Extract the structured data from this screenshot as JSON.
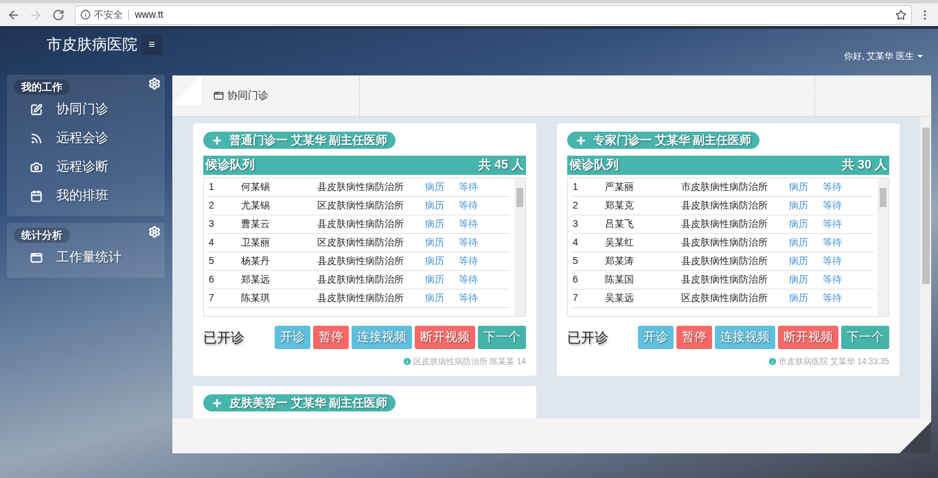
{
  "browser": {
    "security": "不安全",
    "url": "www.tt",
    "forward_disabled": true
  },
  "header": {
    "hospital": "市皮肤病医院",
    "menu_icon": "≡",
    "user": "你好, 艾某华 医生"
  },
  "sidebar": [
    {
      "title": "我的工作",
      "items": [
        {
          "label": "协同门诊"
        },
        {
          "label": "远程会诊"
        },
        {
          "label": "远程诊断"
        },
        {
          "label": "我的排班"
        }
      ]
    },
    {
      "title": "统计分析",
      "items": [
        {
          "label": "工作量统计"
        }
      ]
    }
  ],
  "tabs": [
    {
      "label": "协同门诊"
    }
  ],
  "cards": [
    {
      "title": "普通门诊一 艾某华 副主任医师",
      "queue_label": "候诊队列",
      "count": "共 45 人",
      "rows": [
        {
          "no": "1",
          "name": "何某锡",
          "hospital": "县皮肤病性病防治所",
          "record": "病历",
          "status": "等待"
        },
        {
          "no": "2",
          "name": "尤某锡",
          "hospital": "区皮肤病性病防治所",
          "record": "病历",
          "status": "等待"
        },
        {
          "no": "3",
          "name": "曹某云",
          "hospital": "县皮肤病性病防治所",
          "record": "病历",
          "status": "等待"
        },
        {
          "no": "4",
          "name": "卫某丽",
          "hospital": "区皮肤病性病防治所",
          "record": "病历",
          "status": "等待"
        },
        {
          "no": "5",
          "name": "杨某丹",
          "hospital": "县皮肤病性病防治所",
          "record": "病历",
          "status": "等待"
        },
        {
          "no": "6",
          "name": "郑某远",
          "hospital": "县皮肤病性病防治所",
          "record": "病历",
          "status": "等待"
        },
        {
          "no": "7",
          "name": "陈某琪",
          "hospital": "县皮肤病性病防治所",
          "record": "病历",
          "status": "等待"
        }
      ],
      "state": "已开诊",
      "buttons": [
        {
          "label": "开诊",
          "kind": "info"
        },
        {
          "label": "暂停",
          "kind": "danger"
        },
        {
          "label": "连接视频",
          "kind": "info"
        },
        {
          "label": "断开视频",
          "kind": "danger"
        },
        {
          "label": "下一个",
          "kind": "success"
        }
      ],
      "info": "区皮肤病性病防治所 陈某某 14"
    },
    {
      "title": "专家门诊一 艾某华 副主任医师",
      "queue_label": "候诊队列",
      "count": "共 30 人",
      "rows": [
        {
          "no": "1",
          "name": "严某丽",
          "hospital": "市皮肤病性病防治所",
          "record": "病历",
          "status": "等待"
        },
        {
          "no": "2",
          "name": "郑某克",
          "hospital": "县皮肤病性病防治所",
          "record": "病历",
          "status": "等待"
        },
        {
          "no": "3",
          "name": "吕某飞",
          "hospital": "县皮肤病性病防治所",
          "record": "病历",
          "status": "等待"
        },
        {
          "no": "4",
          "name": "吴某红",
          "hospital": "县皮肤病性病防治所",
          "record": "病历",
          "status": "等待"
        },
        {
          "no": "5",
          "name": "郑某涛",
          "hospital": "县皮肤病性病防治所",
          "record": "病历",
          "status": "等待"
        },
        {
          "no": "6",
          "name": "陈某国",
          "hospital": "县皮肤病性病防治所",
          "record": "病历",
          "status": "等待"
        },
        {
          "no": "7",
          "name": "吴某远",
          "hospital": "区皮肤病性病防治所",
          "record": "病历",
          "status": "等待"
        }
      ],
      "state": "已开诊",
      "buttons": [
        {
          "label": "开诊",
          "kind": "info"
        },
        {
          "label": "暂停",
          "kind": "danger"
        },
        {
          "label": "连接视频",
          "kind": "info"
        },
        {
          "label": "断开视频",
          "kind": "danger"
        },
        {
          "label": "下一个",
          "kind": "success"
        }
      ],
      "info": "市皮肤病医院 艾某华 14:33:35"
    },
    {
      "title": "皮肤美容一 艾某华 副主任医师"
    }
  ]
}
